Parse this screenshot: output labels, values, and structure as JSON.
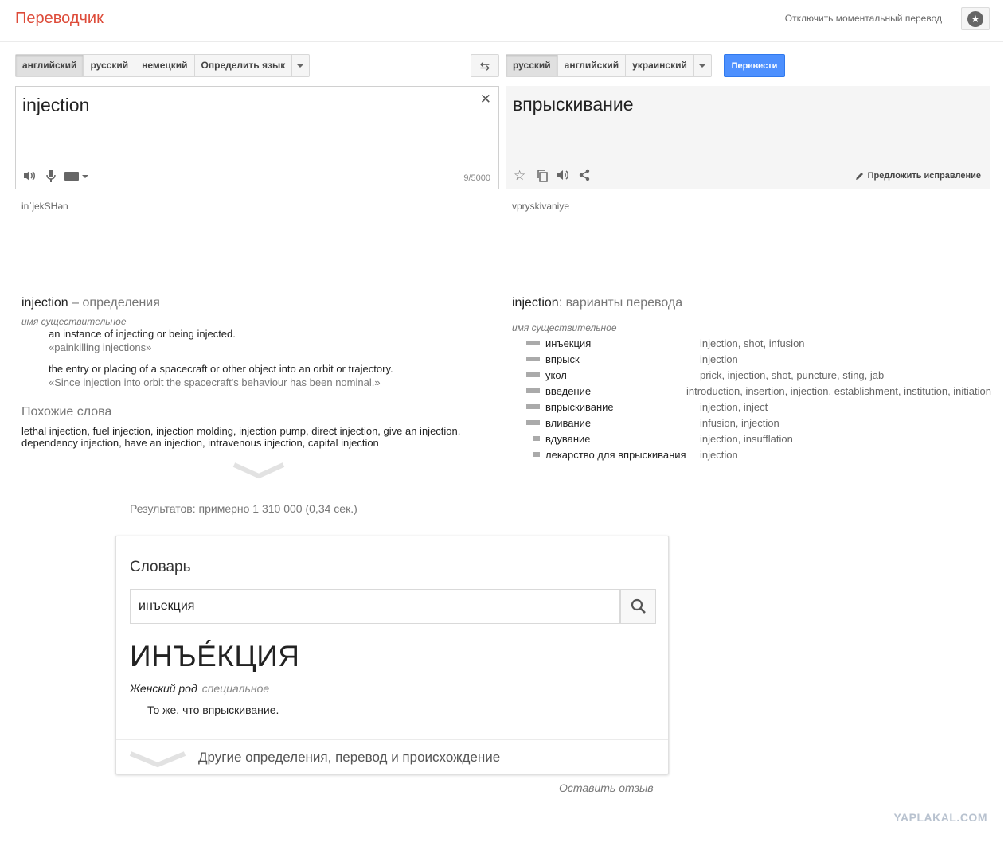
{
  "header": {
    "app_title": "Переводчик",
    "instant_toggle": "Отключить моментальный перевод"
  },
  "source": {
    "langs": [
      "английский",
      "русский",
      "немецкий",
      "Определить язык"
    ],
    "active_index": 0,
    "text": "injection",
    "counter": "9/5000",
    "transliteration": "inˈjekSHən"
  },
  "target": {
    "langs": [
      "русский",
      "английский",
      "украинский"
    ],
    "active_index": 0,
    "translate_button": "Перевести",
    "text": "впрыскивание",
    "suggest_edit": "Предложить исправление",
    "transliteration": "vpryskivaniye"
  },
  "definitions": {
    "word": "injection",
    "heading_suffix": "– определения",
    "part_of_speech": "имя существительное",
    "items": [
      {
        "definition": "an instance of injecting or being injected.",
        "example": "«painkilling injections»"
      },
      {
        "definition": "the entry or placing of a spacecraft or other object into an orbit or trajectory.",
        "example": "«Since injection into orbit the spacecraft's behaviour has been nominal.»"
      }
    ],
    "similar_title": "Похожие слова",
    "similar_line1": "lethal injection, fuel injection, injection molding, injection pump, direct injection, give an injection,",
    "similar_line2": "dependency injection, have an injection, intravenous injection, capital injection"
  },
  "translations": {
    "word": "injection",
    "heading_suffix": ": варианты перевода",
    "part_of_speech": "имя существительное",
    "rows": [
      {
        "word": "инъекция",
        "synonyms": "injection, shot, infusion",
        "frequency": 1.0
      },
      {
        "word": "впрыск",
        "synonyms": "injection",
        "frequency": 1.0
      },
      {
        "word": "укол",
        "synonyms": "prick, injection, shot, puncture, sting, jab",
        "frequency": 1.0
      },
      {
        "word": "введение",
        "synonyms": "introduction, insertion, injection, establishment, institution, initiation",
        "frequency": 1.0
      },
      {
        "word": "впрыскивание",
        "synonyms": "injection, inject",
        "frequency": 1.0
      },
      {
        "word": "вливание",
        "synonyms": "infusion, injection",
        "frequency": 1.0
      },
      {
        "word": "вдувание",
        "synonyms": "injection, insufflation",
        "frequency": 0.5
      },
      {
        "word": "лекарство для впрыскивания",
        "synonyms": "injection",
        "frequency": 0.5
      }
    ]
  },
  "results_text": "Результатов: примерно 1 310 000 (0,34 сек.)",
  "dictionary": {
    "title": "Словарь",
    "search_value": "инъекция",
    "headword": "ИНЪЕ́КЦИЯ",
    "gender": "Женский род",
    "label": "специальное",
    "definition": "То же, что впрыскивание.",
    "more_link": "Другие определения, перевод и происхождение"
  },
  "feedback": "Оставить отзыв",
  "watermark": "YAPLAKAL.COM"
}
